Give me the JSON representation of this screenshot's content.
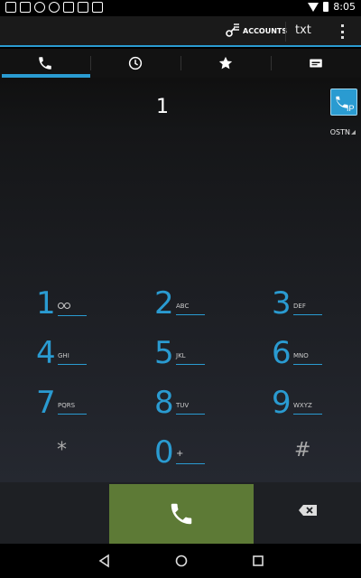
{
  "status_bar": {
    "time": "8:05"
  },
  "action_bar": {
    "accounts_label": "ACCOUNTS",
    "txt_label": "txt"
  },
  "tabs": [
    {
      "icon": "phone-icon"
    },
    {
      "icon": "clock-icon"
    },
    {
      "icon": "star-icon"
    },
    {
      "icon": "contact-card-icon"
    }
  ],
  "dialer": {
    "digits": "1",
    "ip_label": "IP",
    "network_label": "OSTN"
  },
  "keypad": [
    {
      "digit": "1",
      "letters": ""
    },
    {
      "digit": "2",
      "letters": "ABC"
    },
    {
      "digit": "3",
      "letters": "DEF"
    },
    {
      "digit": "4",
      "letters": "GHI"
    },
    {
      "digit": "5",
      "letters": "JKL"
    },
    {
      "digit": "6",
      "letters": "MNO"
    },
    {
      "digit": "7",
      "letters": "PQRS"
    },
    {
      "digit": "8",
      "letters": "TUV"
    },
    {
      "digit": "9",
      "letters": "WXYZ"
    },
    {
      "digit": "*",
      "letters": ""
    },
    {
      "digit": "0",
      "letters": "+"
    },
    {
      "digit": "#",
      "letters": ""
    }
  ],
  "colors": {
    "accent": "#2a9bd1",
    "call_button": "#5d7a36"
  }
}
